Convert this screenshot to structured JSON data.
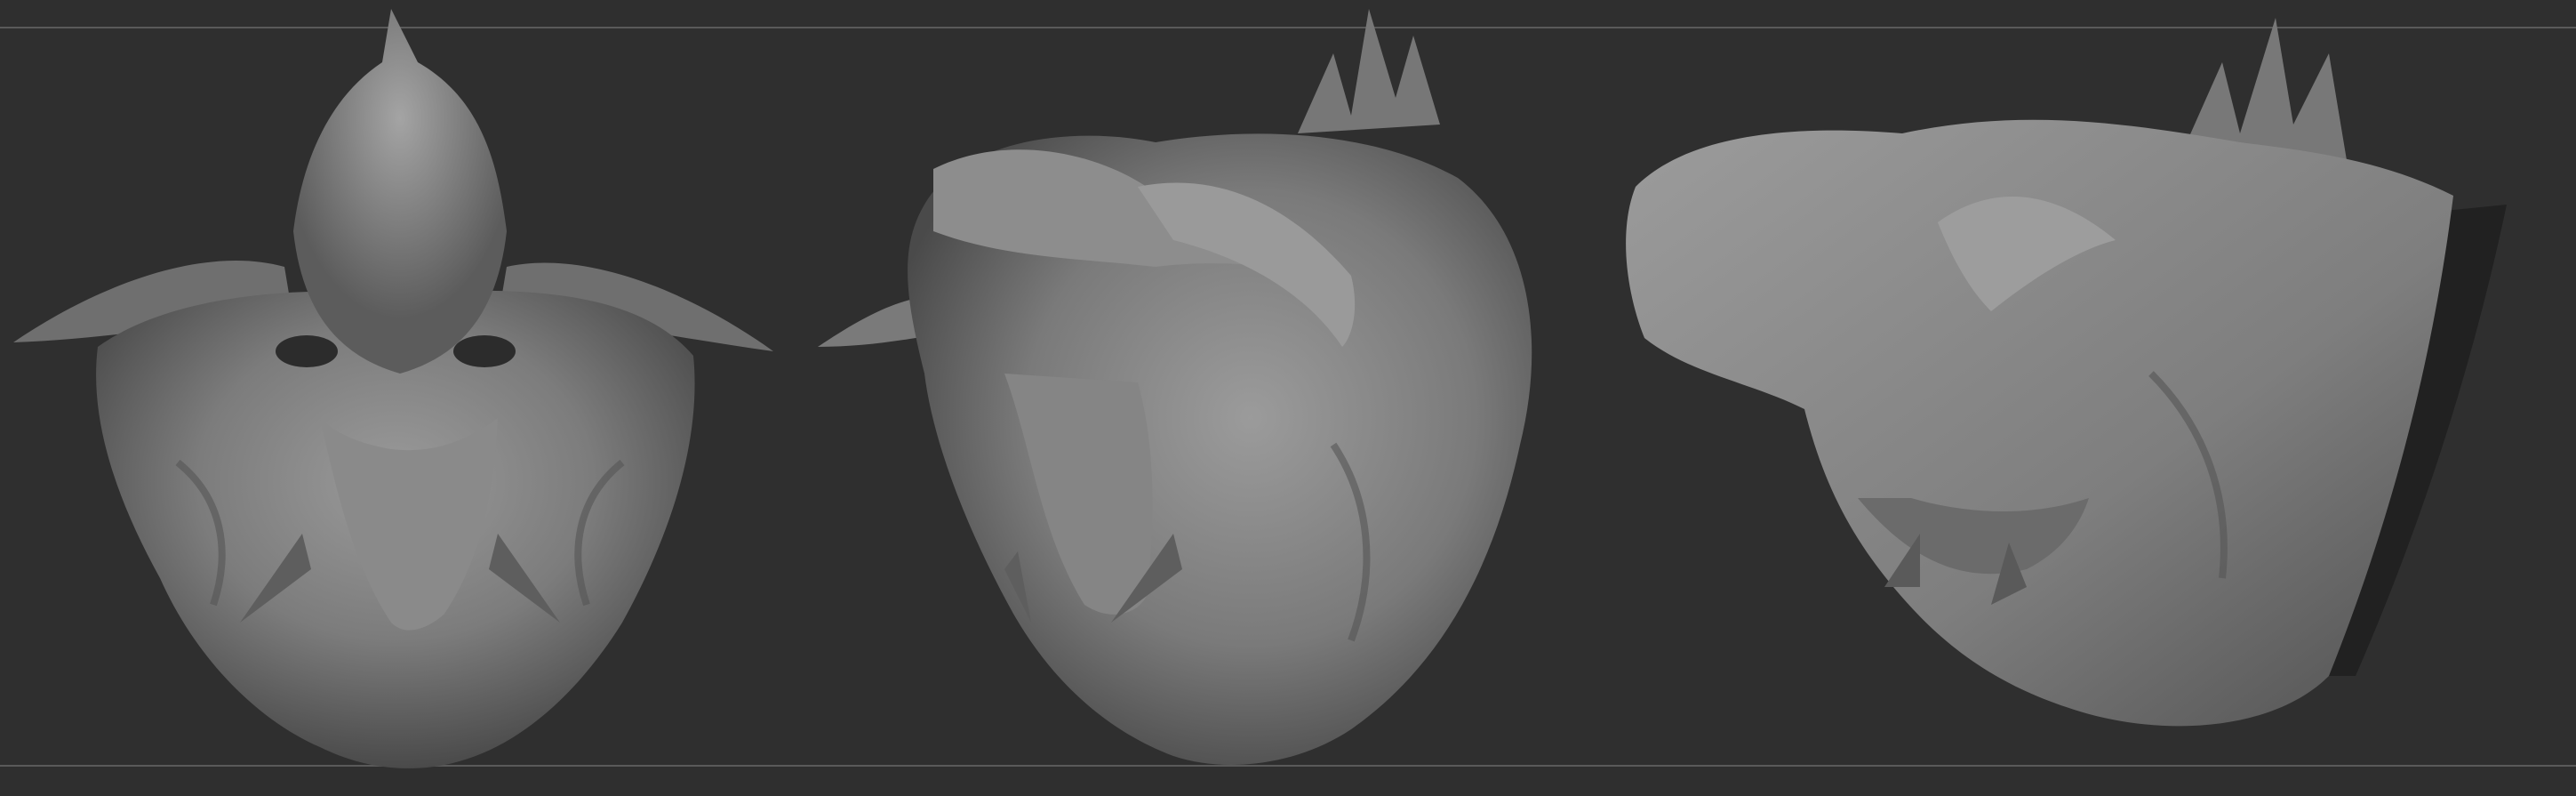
{
  "canvas": {
    "background_color": "#2f2f2f",
    "guide_color": "#5a5a5a",
    "material_color": "#8a8a8a"
  },
  "views": [
    {
      "name": "front-view"
    },
    {
      "name": "three-quarter-view"
    },
    {
      "name": "side-view"
    }
  ]
}
